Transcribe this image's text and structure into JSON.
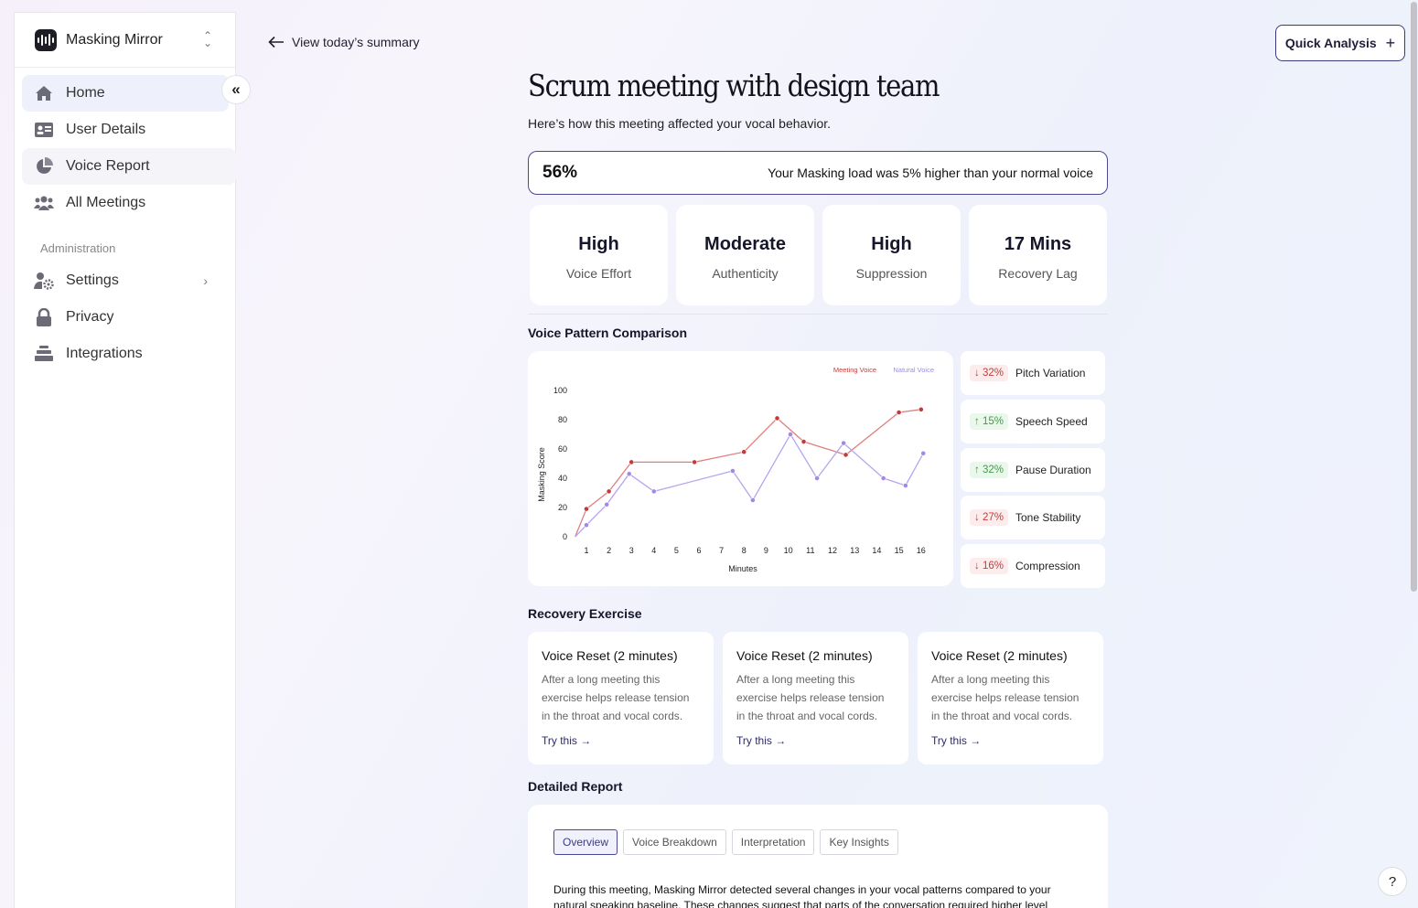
{
  "sidebar": {
    "brand": "Masking Mirror",
    "items": [
      {
        "label": "Home",
        "icon": "home-icon"
      },
      {
        "label": "User Details",
        "icon": "id-card-icon"
      },
      {
        "label": "Voice Report",
        "icon": "pie-chart-icon"
      },
      {
        "label": "All Meetings",
        "icon": "users-icon"
      }
    ],
    "admin_heading": "Administration",
    "admin_items": [
      {
        "label": "Settings",
        "icon": "user-gear-icon"
      },
      {
        "label": "Privacy",
        "icon": "lock-icon"
      },
      {
        "label": "Integrations",
        "icon": "layers-icon"
      }
    ]
  },
  "header": {
    "back_label": "View today’s summary",
    "quick_label": "Quick Analysis"
  },
  "main": {
    "title": "Scrum meeting with design team",
    "subtitle": "Here’s how this meeting affected your vocal behavior.",
    "load_percent": "56%",
    "load_message": "Your Masking load was 5%  higher than your normal voice",
    "stats": [
      {
        "value": "High",
        "label": "Voice Effort"
      },
      {
        "value": "Moderate",
        "label": "Authenticity"
      },
      {
        "value": "High",
        "label": "Suppression"
      },
      {
        "value": "17 Mins",
        "label": "Recovery Lag"
      }
    ],
    "voice_pattern_heading": "Voice Pattern Comparison",
    "metrics": [
      {
        "change": "↓ 32%",
        "label": "Pitch Variation",
        "dir": "down"
      },
      {
        "change": "↑ 15%",
        "label": "Speech Speed",
        "dir": "up"
      },
      {
        "change": "↑ 32%",
        "label": "Pause Duration",
        "dir": "up"
      },
      {
        "change": "↓ 27%",
        "label": "Tone Stability",
        "dir": "down"
      },
      {
        "change": "↓ 16%",
        "label": "Compression",
        "dir": "down"
      }
    ],
    "recovery_heading": "Recovery Exercise",
    "exercises": [
      {
        "title": "Voice Reset (2 minutes)",
        "desc": "After a long meeting this exercise helps release tension in the throat and vocal cords.",
        "link": "Try this →"
      },
      {
        "title": "Voice Reset (2 minutes)",
        "desc": "After a long meeting this exercise helps release tension in the throat and vocal cords.",
        "link": "Try this →"
      },
      {
        "title": "Voice Reset (2 minutes)",
        "desc": "After a long meeting this exercise helps release tension in the throat and vocal cords.",
        "link": "Try this →"
      }
    ],
    "report_heading": "Detailed Report",
    "tabs": [
      "Overview",
      "Voice Breakdown",
      "Interpretation",
      "Key Insights"
    ],
    "report_text": "During this meeting, Masking Mirror detected several changes in your vocal patterns compared to your natural speaking baseline. These changes suggest that parts of the conversation required higher level"
  },
  "help_label": "?",
  "colors": {
    "accent": "#4a4894",
    "meeting": "#e07f7f",
    "natural": "#b9a4ee"
  },
  "chart_data": {
    "type": "line",
    "xlabel": "Minutes",
    "ylabel": "Masking Score",
    "x_ticks": [
      "1",
      "2",
      "3",
      "4",
      "5",
      "6",
      "7",
      "8",
      "9",
      "10",
      "11",
      "12",
      "13",
      "14",
      "15",
      "16"
    ],
    "y_ticks": [
      "0",
      "20",
      "40",
      "60",
      "80",
      "100"
    ],
    "ylim": [
      0,
      100
    ],
    "grid": false,
    "legend": "top-right",
    "series": [
      {
        "name": "Meeting Voice",
        "points": [
          [
            0.5,
            0
          ],
          [
            1,
            19
          ],
          [
            2,
            31
          ],
          [
            3,
            51
          ],
          [
            5.8,
            51
          ],
          [
            8,
            58
          ],
          [
            9.5,
            81
          ],
          [
            10.7,
            65
          ],
          [
            12.6,
            56
          ],
          [
            15,
            85
          ],
          [
            16,
            87
          ]
        ]
      },
      {
        "name": "Natural Voice",
        "points": [
          [
            0.5,
            0
          ],
          [
            1,
            8
          ],
          [
            1.9,
            22
          ],
          [
            2.9,
            43
          ],
          [
            4,
            31
          ],
          [
            7.5,
            45
          ],
          [
            8.4,
            25
          ],
          [
            10.1,
            70
          ],
          [
            11.3,
            40
          ],
          [
            12.5,
            64
          ],
          [
            14.3,
            40
          ],
          [
            15.3,
            35
          ],
          [
            16.1,
            57
          ]
        ]
      }
    ]
  }
}
